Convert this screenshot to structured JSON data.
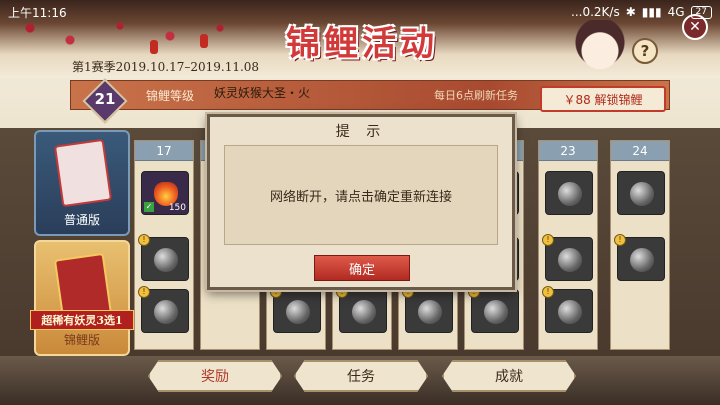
{
  "status_bar": {
    "time": "上午11:16",
    "network": "...0.2K/s",
    "signal": "4G",
    "battery": "27"
  },
  "event": {
    "title": "锦鲤活动",
    "season": "第1赛季2019.10.17–2019.11.08",
    "help_label": "?",
    "close_label": "✕"
  },
  "level_bar": {
    "level": "21",
    "label": "锦鲤等级",
    "reward_name": "妖灵妖猴大圣・火",
    "refresh_text": "每日6点刷新任务",
    "unlock_button": "￥88 解锁锦鲤"
  },
  "tabs": {
    "normal": "普通版",
    "koi": "锦鲤版",
    "super_ribbon": "超稀有妖灵3选1"
  },
  "columns": [
    {
      "number": "17",
      "top_count": "150"
    },
    {
      "number": "23"
    },
    {
      "number": "24"
    }
  ],
  "modal": {
    "title": "提 示",
    "message": "网络断开，请点击确定重新连接",
    "confirm": "确定"
  },
  "bottom_nav": {
    "rewards": "奖励",
    "tasks": "任务",
    "achievements": "成就"
  },
  "colors": {
    "accent_red": "#b02a22",
    "panel_beige": "#ece1cc"
  }
}
